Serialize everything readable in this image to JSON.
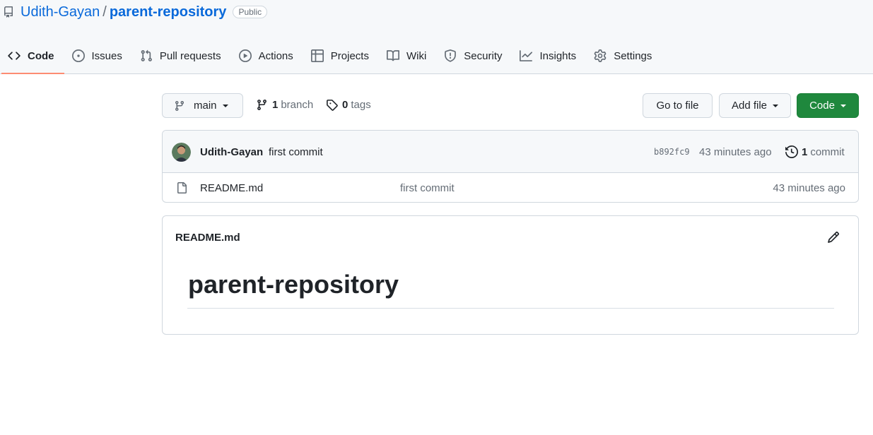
{
  "repo": {
    "owner": "Udith-Gayan",
    "separator": "/",
    "name": "parent-repository",
    "visibility": "Public"
  },
  "tabs": [
    {
      "label": "Code",
      "icon": "code-icon",
      "active": true
    },
    {
      "label": "Issues",
      "icon": "issue-opened-icon"
    },
    {
      "label": "Pull requests",
      "icon": "git-pull-request-icon"
    },
    {
      "label": "Actions",
      "icon": "play-icon"
    },
    {
      "label": "Projects",
      "icon": "table-icon"
    },
    {
      "label": "Wiki",
      "icon": "book-icon"
    },
    {
      "label": "Security",
      "icon": "shield-icon"
    },
    {
      "label": "Insights",
      "icon": "graph-icon"
    },
    {
      "label": "Settings",
      "icon": "gear-icon"
    }
  ],
  "toolbar": {
    "branch": "main",
    "branch_count": "1",
    "branch_label": "branch",
    "tag_count": "0",
    "tag_label": "tags",
    "goto_file": "Go to file",
    "add_file": "Add file",
    "code": "Code"
  },
  "latest_commit": {
    "author": "Udith-Gayan",
    "message": "first commit",
    "sha": "b892fc9",
    "time": "43 minutes ago",
    "commit_count": "1",
    "commit_label": "commit"
  },
  "files": [
    {
      "name": "README.md",
      "commit_message": "first commit",
      "time": "43 minutes ago",
      "icon": "file-icon"
    }
  ],
  "readme": {
    "filename": "README.md",
    "heading": "parent-repository"
  },
  "colors": {
    "link": "#0969da",
    "primary_button": "#1f883d",
    "active_tab_underline": "#fd8c73",
    "header_bg": "#f6f8fa",
    "border": "#d0d7de"
  }
}
